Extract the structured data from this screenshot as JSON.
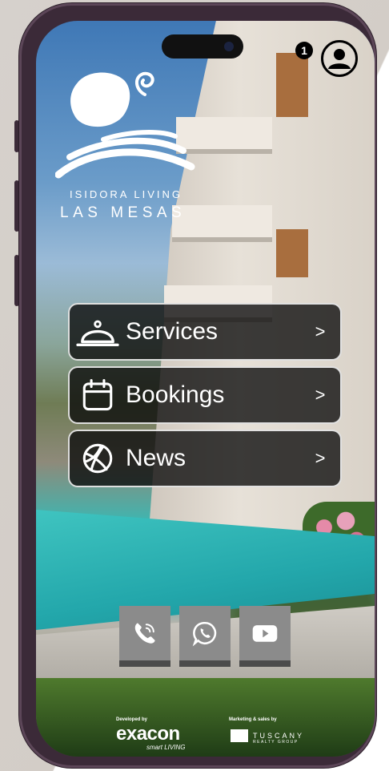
{
  "brand": {
    "line1": "ISIDORA LIVING",
    "line2": "LAS MESAS"
  },
  "notifications": {
    "count": "1"
  },
  "menu": [
    {
      "label": "Services",
      "icon": "service-bell-icon",
      "chevron": ">"
    },
    {
      "label": "Bookings",
      "icon": "calendar-icon",
      "chevron": ">"
    },
    {
      "label": "News",
      "icon": "basketball-icon",
      "chevron": ">"
    }
  ],
  "social": [
    {
      "icon": "phone-icon"
    },
    {
      "icon": "whatsapp-icon"
    },
    {
      "icon": "youtube-icon"
    }
  ],
  "footer": {
    "developed_by": "Developed by",
    "developer": "exacon",
    "developer_sub": "smart LIVING",
    "marketing_by": "Marketing & sales by",
    "agency": "TUSCANY",
    "agency_sub": "REALTY GROUP"
  },
  "colors": {
    "button_bg": "#0a0a0a",
    "social_bg": "#8b8b8b",
    "frame": "#3b2a38"
  }
}
